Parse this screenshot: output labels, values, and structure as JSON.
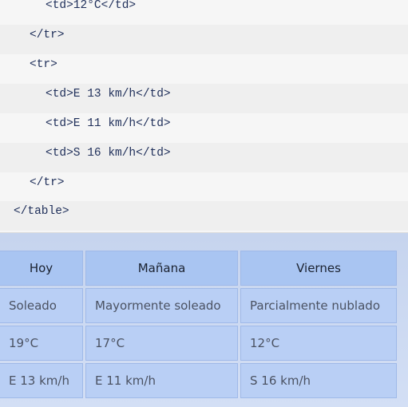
{
  "code_lines": [
    {
      "text": "<td>12°C</td>",
      "indent": 2
    },
    {
      "text": "</tr>",
      "indent": 1
    },
    {
      "text": "<tr>",
      "indent": 1
    },
    {
      "text": "<td>E 13 km/h</td>",
      "indent": 2
    },
    {
      "text": "<td>E 11 km/h</td>",
      "indent": 2
    },
    {
      "text": "<td>S 16 km/h</td>",
      "indent": 2
    },
    {
      "text": "</tr>",
      "indent": 1
    },
    {
      "text": "</table>",
      "indent": 0
    }
  ],
  "forecast_table": {
    "headers": [
      "Hoy",
      "Mañana",
      "Viernes"
    ],
    "rows": [
      [
        "Soleado",
        "Mayormente soleado",
        "Parcialmente nublado"
      ],
      [
        "19°C",
        "17°C",
        "12°C"
      ],
      [
        "E 13 km/h",
        "E 11 km/h",
        "S 16 km/h"
      ]
    ]
  }
}
